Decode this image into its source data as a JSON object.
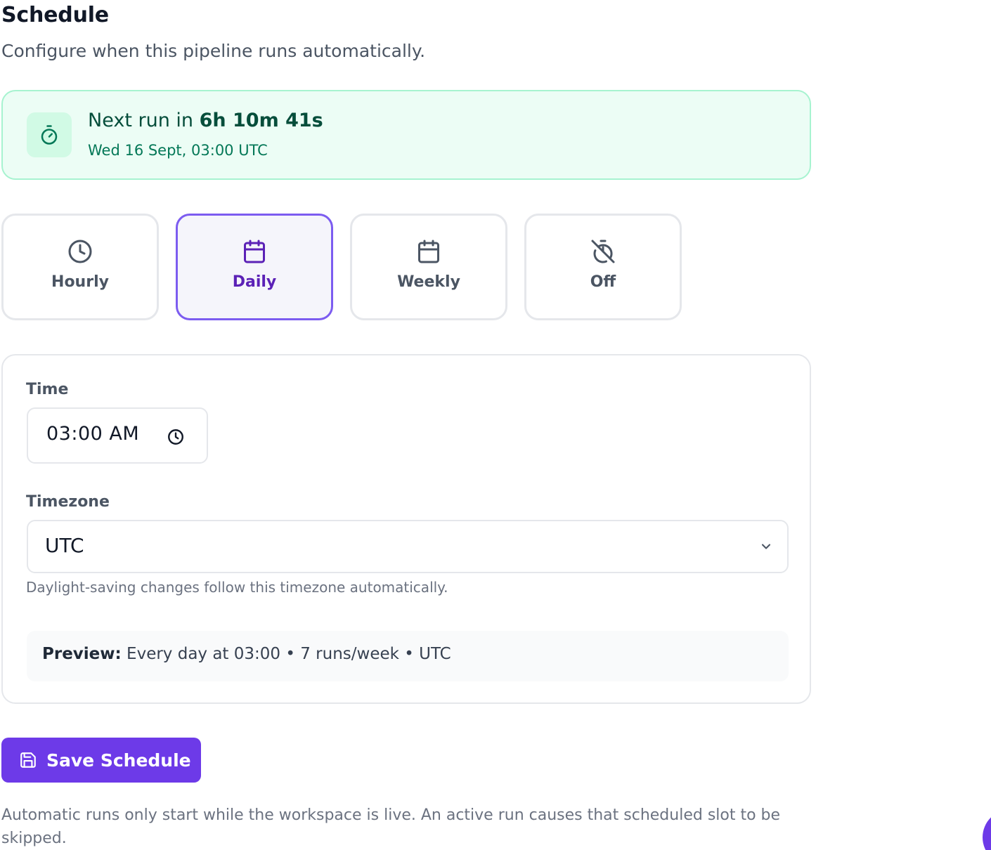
{
  "header": {
    "title": "Schedule",
    "subtitle": "Configure when this pipeline runs automatically."
  },
  "next_run": {
    "prefix": "Next run in ",
    "countdown": "6h 10m 41s",
    "datetime": "Wed 16 Sept, 03:00 UTC",
    "icon": "stopwatch-icon"
  },
  "frequency": {
    "selected": "Daily",
    "options": [
      {
        "label": "Hourly",
        "icon": "clock-icon"
      },
      {
        "label": "Daily",
        "icon": "calendar-icon"
      },
      {
        "label": "Weekly",
        "icon": "calendar-icon"
      },
      {
        "label": "Off",
        "icon": "timer-off-icon"
      }
    ]
  },
  "time": {
    "label": "Time",
    "value": "03:00 AM"
  },
  "timezone": {
    "label": "Timezone",
    "value": "UTC",
    "help": "Daylight-saving changes follow this timezone automatically."
  },
  "preview": {
    "label": "Preview:",
    "text": " Every day at 03:00 • 7 runs/week • UTC"
  },
  "actions": {
    "save_label": "Save Schedule"
  },
  "footer": {
    "note": "Automatic runs only start while the workspace is live. An active run causes that scheduled slot to be skipped."
  },
  "colors": {
    "accent": "#6d3ae8",
    "selected_border": "#7c5cf0",
    "success_bg": "#ecfdf5",
    "success_text": "#047857"
  }
}
